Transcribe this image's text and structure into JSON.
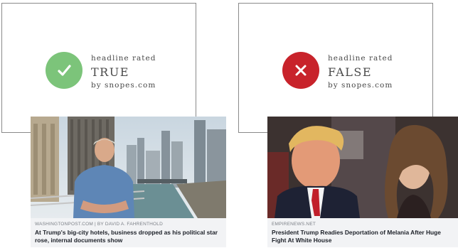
{
  "true_box": {
    "line1": "headline rated",
    "verdict": "TRUE",
    "line3": "by snopes.com",
    "color": "#7cc47a"
  },
  "false_box": {
    "line1": "headline rated",
    "verdict": "FALSE",
    "line3": "by snopes.com",
    "color": "#c8232b"
  },
  "left_article": {
    "source": "WASHINGTONPOST.COM | BY DAVID A. FAHRENTHOLD",
    "headline": "At Trump's big-city hotels, business dropped as his political star rose, internal documents show"
  },
  "right_article": {
    "source": "EMPIRENEWS.NET",
    "headline": "President Trump Readies Deportation of Melania After Huge Fight At White House"
  }
}
